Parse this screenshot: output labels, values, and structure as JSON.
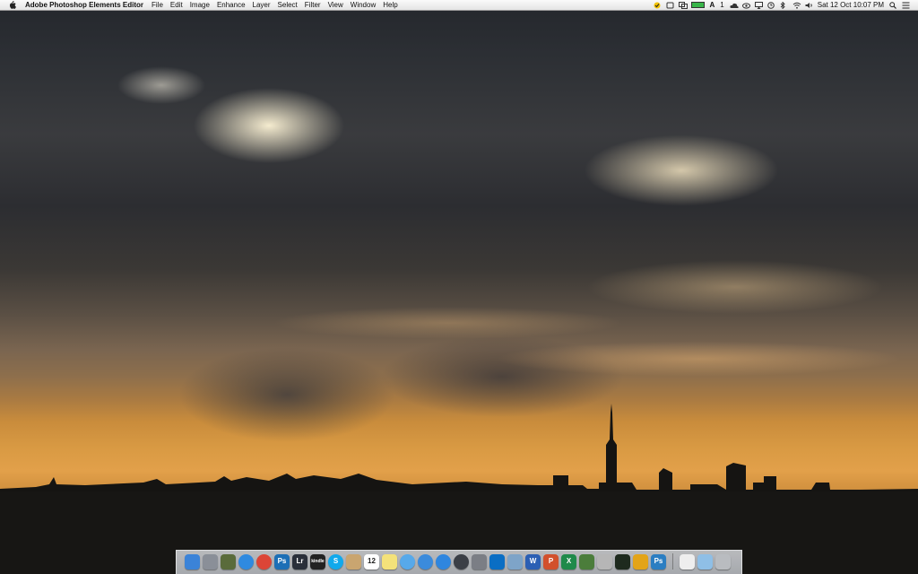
{
  "menubar": {
    "app_name": "Adobe Photoshop Elements Editor",
    "menus": [
      "File",
      "Edit",
      "Image",
      "Enhance",
      "Layer",
      "Select",
      "Filter",
      "View",
      "Window",
      "Help"
    ],
    "status": {
      "adobe_count": "1",
      "clock": "Sat 12 Oct  10:07 PM"
    }
  },
  "dock": {
    "icons": [
      {
        "name": "finder-icon",
        "color": "#3b83d8"
      },
      {
        "name": "launchpad-icon",
        "color": "#8a8f98"
      },
      {
        "name": "mission-control-icon",
        "color": "#5a6b3b"
      },
      {
        "name": "safari-icon",
        "color": "#2f8ae0"
      },
      {
        "name": "chrome-icon",
        "color": "#dc4537"
      },
      {
        "name": "photoshop-elements-icon",
        "color": "#1c6fb6",
        "label": "Ps"
      },
      {
        "name": "lightroom-icon",
        "color": "#2a2f3a",
        "label": "Lr"
      },
      {
        "name": "kindle-icon",
        "color": "#222222",
        "label": "kindle"
      },
      {
        "name": "skype-icon",
        "color": "#11a9ec",
        "label": "S"
      },
      {
        "name": "contacts-icon",
        "color": "#c9a570"
      },
      {
        "name": "calendar-icon",
        "color": "#ffffff",
        "label": "12"
      },
      {
        "name": "notes-icon",
        "color": "#f4e27a"
      },
      {
        "name": "messages-icon",
        "color": "#57a9ea"
      },
      {
        "name": "itunes-icon",
        "color": "#3b8bdc"
      },
      {
        "name": "app-store-icon",
        "color": "#2f86df"
      },
      {
        "name": "time-machine-icon",
        "color": "#3b3f46"
      },
      {
        "name": "preferences-icon",
        "color": "#7b7e85"
      },
      {
        "name": "onedrive-icon",
        "color": "#0a6ec4"
      },
      {
        "name": "preview-icon",
        "color": "#7ea4c8"
      },
      {
        "name": "word-icon",
        "color": "#2b5fb4",
        "label": "W"
      },
      {
        "name": "powerpoint-icon",
        "color": "#d2502c",
        "label": "P"
      },
      {
        "name": "excel-icon",
        "color": "#1f8a4a",
        "label": "X"
      },
      {
        "name": "directory-utility-icon",
        "color": "#4b7d3b"
      },
      {
        "name": "script-editor-icon",
        "color": "#b6b6b6"
      },
      {
        "name": "activity-monitor-icon",
        "color": "#1e2a1e"
      },
      {
        "name": "vmware-icon",
        "color": "#e3a418"
      },
      {
        "name": "photoshop-icon",
        "color": "#2b7ec2",
        "label": "Ps"
      },
      {
        "name": "document-icon",
        "color": "#eeeeee"
      },
      {
        "name": "downloads-folder-icon",
        "color": "#8fbfe6"
      },
      {
        "name": "trash-icon",
        "color": "#b9bcc0"
      }
    ]
  }
}
